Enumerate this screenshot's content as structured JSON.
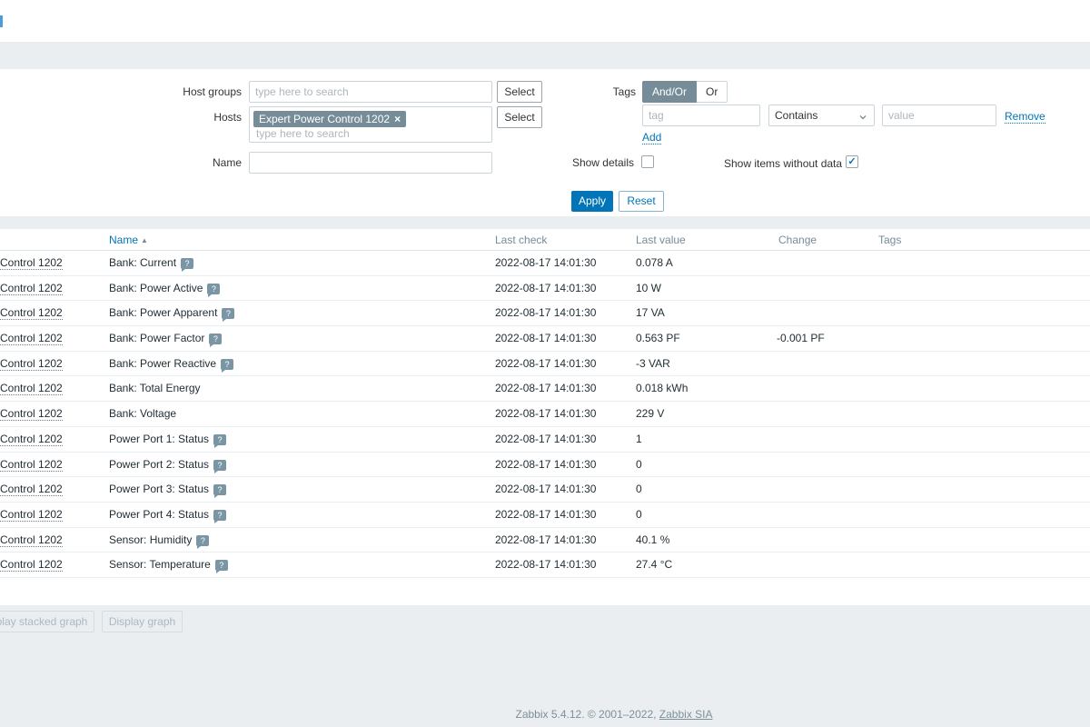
{
  "colors": {
    "accent_blue": "#0275b8",
    "panel_gray": "#ebeef0",
    "chip_gray": "#768d99",
    "help_icon_gray": "#7a96a5"
  },
  "filter": {
    "host_groups_label": "Host groups",
    "host_groups_placeholder": "type here to search",
    "host_groups_select_button": "Select",
    "hosts_label": "Hosts",
    "hosts_chip": "Expert Power Control 1202",
    "hosts_chip_remove_glyph": "×",
    "hosts_placeholder": "type here to search",
    "hosts_select_button": "Select",
    "name_label": "Name",
    "name_value": "",
    "tags_label": "Tags",
    "tag_operator_and_or": "And/Or",
    "tag_operator_or": "Or",
    "tag_operator_selected": "And/Or",
    "tag_placeholder": "tag",
    "tag_condition_selected": "Contains",
    "value_placeholder": "value",
    "remove_link": "Remove",
    "add_link": "Add",
    "show_details_label": "Show details",
    "show_details_checked": false,
    "show_items_label": "Show items without data",
    "show_items_checked": true,
    "apply_button": "Apply",
    "reset_button": "Reset"
  },
  "table": {
    "headers": {
      "name": "Name",
      "last_check": "Last check",
      "last_value": "Last value",
      "change": "Change",
      "tags": "Tags"
    },
    "sort_arrow": "▲",
    "help_icon_glyph": "?",
    "rows": [
      {
        "host": "Control 1202",
        "name": "Bank: Current",
        "help": true,
        "last_check": "2022-08-17 14:01:30",
        "last_value": "0.078 A",
        "change": ""
      },
      {
        "host": "Control 1202",
        "name": "Bank: Power Active",
        "help": true,
        "last_check": "2022-08-17 14:01:30",
        "last_value": "10 W",
        "change": ""
      },
      {
        "host": "Control 1202",
        "name": "Bank: Power Apparent",
        "help": true,
        "last_check": "2022-08-17 14:01:30",
        "last_value": "17 VA",
        "change": ""
      },
      {
        "host": "Control 1202",
        "name": "Bank: Power Factor",
        "help": true,
        "last_check": "2022-08-17 14:01:30",
        "last_value": "0.563 PF",
        "change": "-0.001 PF"
      },
      {
        "host": "Control 1202",
        "name": "Bank: Power Reactive",
        "help": true,
        "last_check": "2022-08-17 14:01:30",
        "last_value": "-3 VAR",
        "change": ""
      },
      {
        "host": "Control 1202",
        "name": "Bank: Total Energy",
        "help": false,
        "last_check": "2022-08-17 14:01:30",
        "last_value": "0.018 kWh",
        "change": ""
      },
      {
        "host": "Control 1202",
        "name": "Bank: Voltage",
        "help": false,
        "last_check": "2022-08-17 14:01:30",
        "last_value": "229 V",
        "change": ""
      },
      {
        "host": "Control 1202",
        "name": "Power Port 1: Status",
        "help": true,
        "last_check": "2022-08-17 14:01:30",
        "last_value": "1",
        "change": ""
      },
      {
        "host": "Control 1202",
        "name": "Power Port 2: Status",
        "help": true,
        "last_check": "2022-08-17 14:01:30",
        "last_value": "0",
        "change": ""
      },
      {
        "host": "Control 1202",
        "name": "Power Port 3: Status",
        "help": true,
        "last_check": "2022-08-17 14:01:30",
        "last_value": "0",
        "change": ""
      },
      {
        "host": "Control 1202",
        "name": "Power Port 4: Status",
        "help": true,
        "last_check": "2022-08-17 14:01:30",
        "last_value": "0",
        "change": ""
      },
      {
        "host": "Control 1202",
        "name": "Sensor: Humidity",
        "help": true,
        "last_check": "2022-08-17 14:01:30",
        "last_value": "40.1 %",
        "change": ""
      },
      {
        "host": "Control 1202",
        "name": "Sensor: Temperature",
        "help": true,
        "last_check": "2022-08-17 14:01:30",
        "last_value": "27.4 °C",
        "change": ""
      }
    ]
  },
  "actions": {
    "stacked_graph_button": "play stacked graph",
    "graph_button": "Display graph"
  },
  "footer": {
    "version_text": "Zabbix 5.4.12. © 2001–2022, ",
    "link_text": "Zabbix SIA"
  }
}
